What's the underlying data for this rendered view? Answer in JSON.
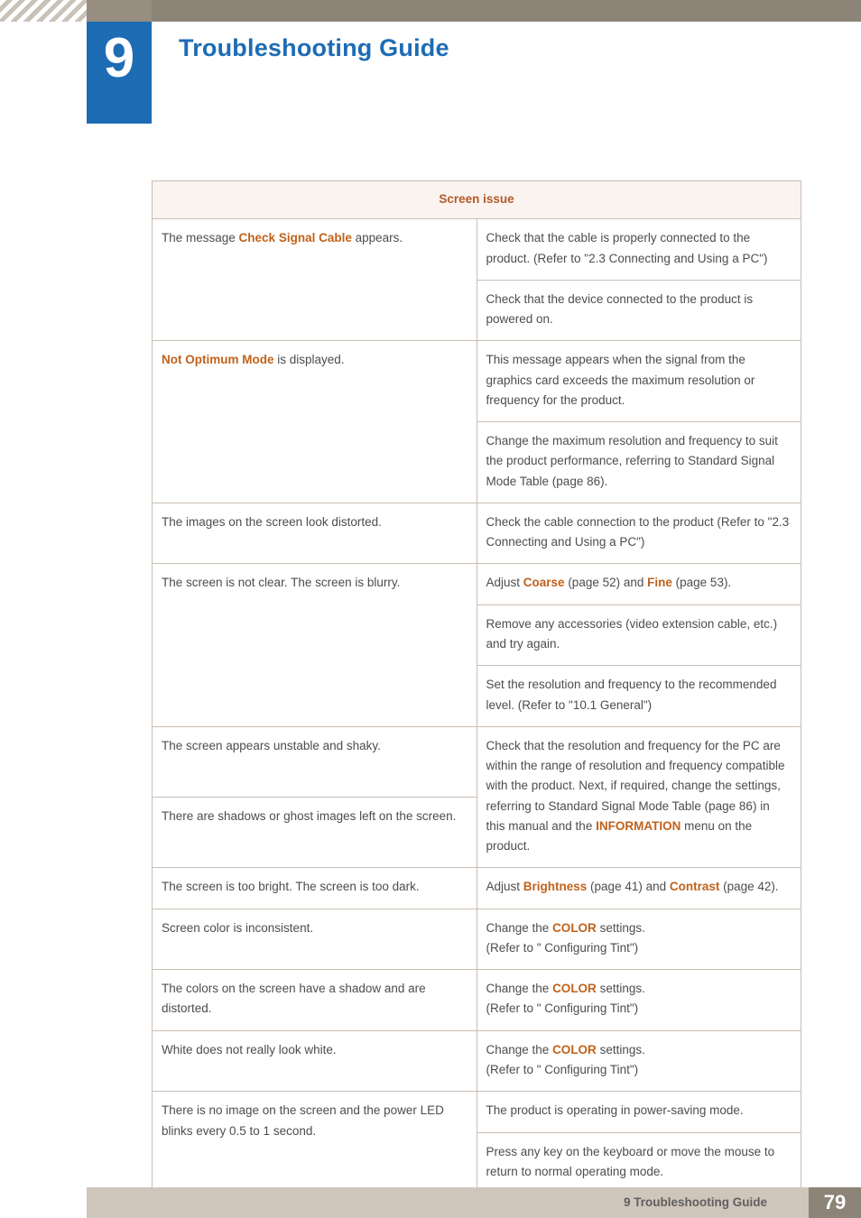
{
  "header": {
    "chapter_number": "9",
    "chapter_title": "Troubleshooting Guide"
  },
  "footer": {
    "label": "9 Troubleshooting Guide",
    "page_number": "79"
  },
  "table": {
    "head": "Screen issue",
    "rows": [
      {
        "issue_prefix": "The message ",
        "issue_highlight": "Check Signal Cable",
        "issue_suffix": " appears.",
        "solutions": [
          {
            "text": "Check that the cable is properly connected to the product. (Refer to \"2.3 Connecting and Using a PC\")"
          },
          {
            "text": "Check that the device connected to the product is powered on."
          }
        ]
      },
      {
        "issue_prefix": "",
        "issue_highlight": "Not Optimum Mode",
        "issue_suffix": " is displayed.",
        "solutions": [
          {
            "text": "This message appears when the signal from the graphics card exceeds the maximum resolution or frequency for the product."
          },
          {
            "text": "Change the maximum resolution and frequency to suit the product performance, referring to Standard Signal Mode Table (page 86)."
          }
        ]
      },
      {
        "issue_prefix": "The images on the screen look distorted.",
        "issue_highlight": "",
        "issue_suffix": "",
        "solutions": [
          {
            "text": "Check the cable connection to the product (Refer to \"2.3 Connecting and Using a PC\")"
          }
        ]
      },
      {
        "issue_prefix": "The screen is not clear. The screen is blurry.",
        "issue_highlight": "",
        "issue_suffix": "",
        "solutions": [
          {
            "prefix": "Adjust ",
            "highlight": "Coarse",
            "mid": " (page 52) and ",
            "highlight2": "Fine",
            "suffix": " (page 53)."
          },
          {
            "text": "Remove any accessories (video extension cable, etc.) and try again."
          },
          {
            "text": "Set the resolution and frequency to the recommended level. (Refer to \"10.1 General\")"
          }
        ]
      },
      {
        "issue_prefix": "The screen appears unstable and shaky.",
        "issue_highlight": "",
        "issue_suffix": "",
        "issue2": "There are shadows or ghost images left on the screen.",
        "solutions": [
          {
            "prefix": "Check that the resolution and frequency for the PC are within the range of resolution and frequency compatible with the product. Next, if required, change the settings, referring to Standard Signal Mode Table (page 86) in this manual and the ",
            "highlight": "INFORMATION",
            "suffix": " menu on the product."
          }
        ]
      },
      {
        "issue_prefix": "The screen is too bright. The screen is too dark.",
        "issue_highlight": "",
        "issue_suffix": "",
        "solutions": [
          {
            "prefix": "Adjust ",
            "highlight": "Brightness",
            "mid": " (page 41) and ",
            "highlight2": "Contrast",
            "suffix": " (page 42)."
          }
        ]
      },
      {
        "issue_prefix": "Screen color is inconsistent.",
        "issue_highlight": "",
        "issue_suffix": "",
        "solutions": [
          {
            "prefix": "Change the ",
            "highlight": "COLOR",
            "suffix": " settings.\n(Refer to \" Configuring Tint\")"
          }
        ]
      },
      {
        "issue_prefix": "The colors on the screen have a shadow and are distorted.",
        "issue_highlight": "",
        "issue_suffix": "",
        "solutions": [
          {
            "prefix": "Change the ",
            "highlight": "COLOR",
            "suffix": " settings.\n(Refer to \" Configuring Tint\")"
          }
        ]
      },
      {
        "issue_prefix": "White does not really look white.",
        "issue_highlight": "",
        "issue_suffix": "",
        "solutions": [
          {
            "prefix": "Change the ",
            "highlight": "COLOR",
            "suffix": " settings.\n(Refer to \" Configuring Tint\")"
          }
        ]
      },
      {
        "issue_prefix": "There is no image on the screen and the power LED blinks every 0.5 to 1 second.",
        "issue_highlight": "",
        "issue_suffix": "",
        "solutions": [
          {
            "text": "The product is operating in power-saving mode."
          },
          {
            "text": "Press any key on the keyboard or move the mouse to return to normal operating mode."
          }
        ]
      }
    ]
  }
}
